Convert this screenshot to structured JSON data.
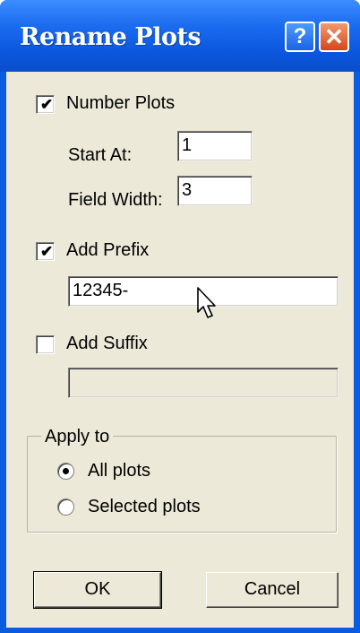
{
  "window": {
    "title": "Rename Plots",
    "help_label": "?",
    "close_label": "✕"
  },
  "number_plots": {
    "label": "Number Plots",
    "checked": true,
    "start_at_label": "Start At:",
    "start_at_value": "1",
    "field_width_label": "Field Width:",
    "field_width_value": "3"
  },
  "prefix": {
    "label": "Add Prefix",
    "checked": true,
    "value": "12345-"
  },
  "suffix": {
    "label": "Add Suffix",
    "checked": false,
    "value": ""
  },
  "apply_to": {
    "legend": "Apply to",
    "options": [
      "All plots",
      "Selected plots"
    ],
    "selected": "All plots"
  },
  "buttons": {
    "ok": "OK",
    "cancel": "Cancel"
  },
  "icons": {
    "check": "✔"
  }
}
